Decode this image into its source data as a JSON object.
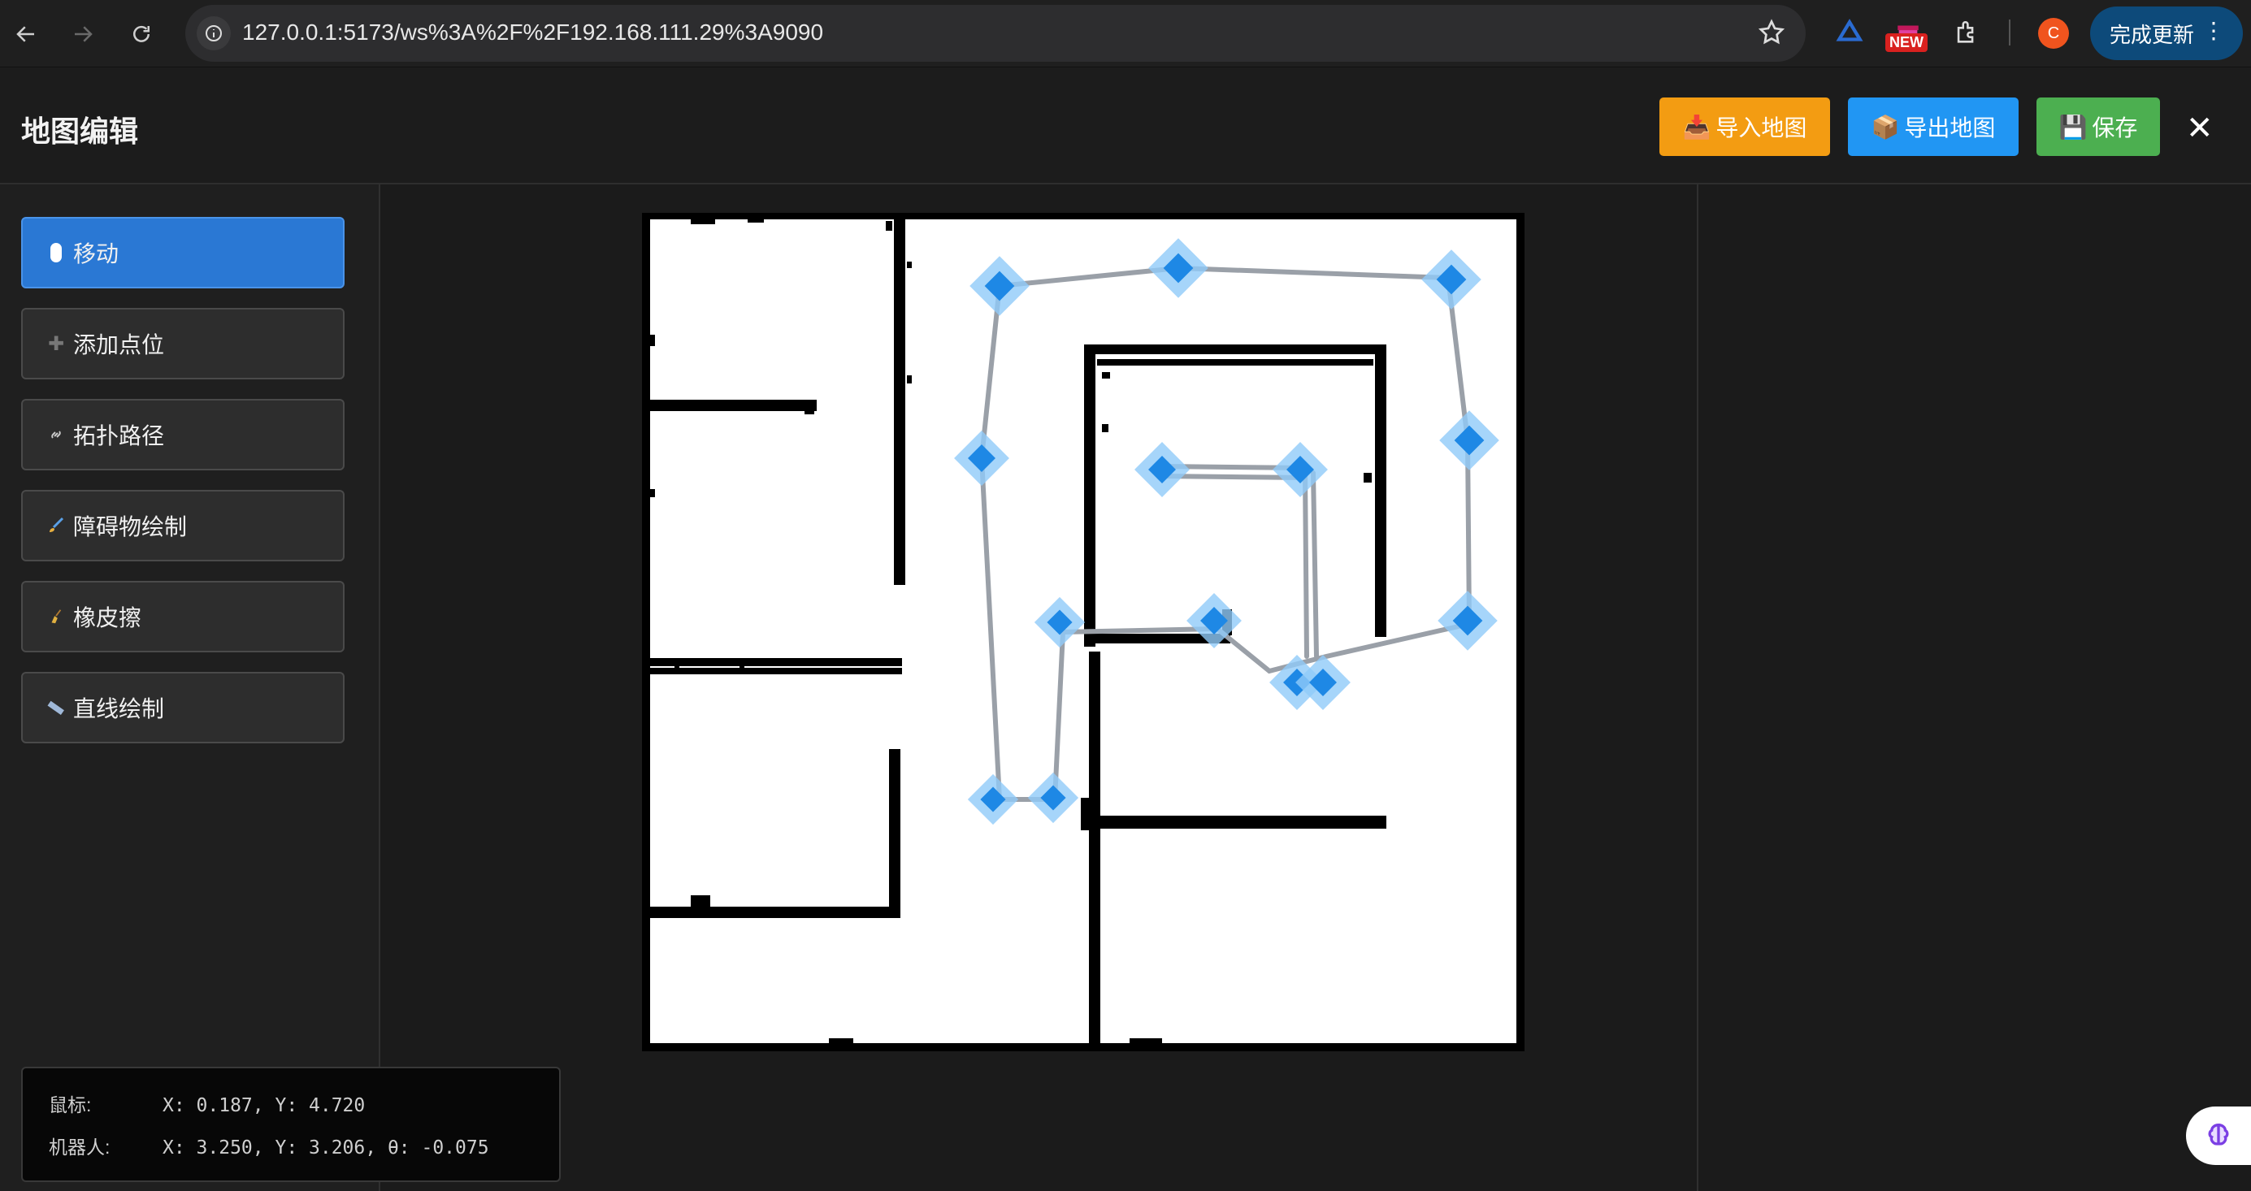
{
  "browser": {
    "url": "127.0.0.1:5173/ws%3A%2F%2F192.168.111.29%3A9090",
    "new_badge": "NEW",
    "profile_initial": "C",
    "update_label": "完成更新"
  },
  "header": {
    "title": "地图编辑",
    "import_label": "导入地图",
    "export_label": "导出地图",
    "save_label": "保存",
    "close": "✕",
    "colors": {
      "import": "#f39c12",
      "export": "#2196f3",
      "save": "#4caf50"
    }
  },
  "tools": [
    {
      "label": "移动",
      "icon": "mouse-icon",
      "active": true
    },
    {
      "label": "添加点位",
      "icon": "plus-icon",
      "active": false
    },
    {
      "label": "拓扑路径",
      "icon": "link-icon",
      "active": false
    },
    {
      "label": "障碍物绘制",
      "icon": "brush-icon",
      "active": false
    },
    {
      "label": "橡皮擦",
      "icon": "broom-icon",
      "active": false
    },
    {
      "label": "直线绘制",
      "icon": "ruler-icon",
      "active": false
    }
  ],
  "status": {
    "mouse_label": "鼠标:",
    "mouse_value": "X: 0.187, Y: 4.720",
    "robot_label": "机器人:",
    "robot_value": "X: 3.250, Y: 3.206, θ: -0.075"
  },
  "map": {
    "accent": "#2196f3",
    "path_color": "#9aa0a8"
  }
}
